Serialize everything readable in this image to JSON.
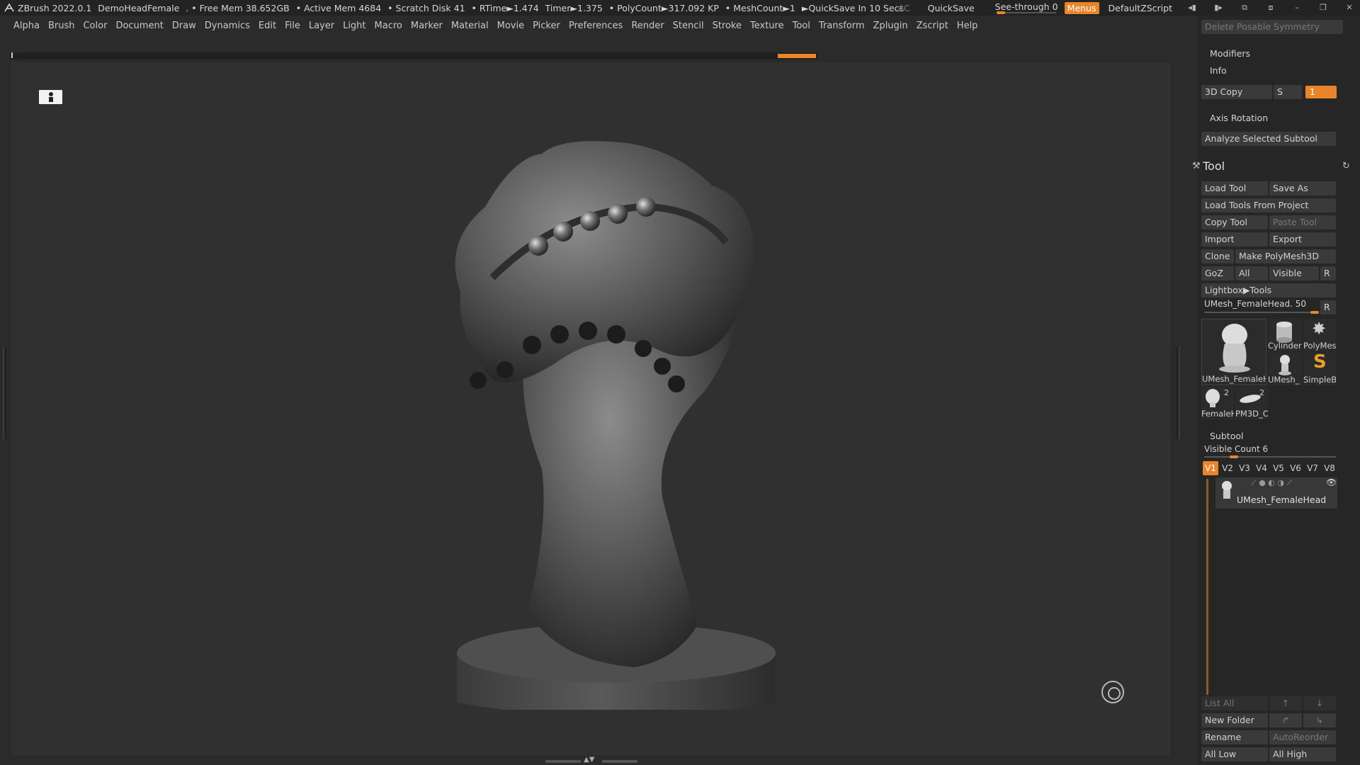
{
  "titlebar": {
    "app": "ZBrush 2022.0.1",
    "project": "DemoHeadFemale",
    "stats": [
      ". • Free Mem 38.652GB",
      "• Active Mem 4684",
      "• Scratch Disk 41",
      "• RTime►1.474",
      "Timer►1.375",
      "• PolyCount►317.092 KP",
      "• MeshCount►1",
      "►QuickSave In 10 Secs"
    ],
    "ac": "AC",
    "quicksave": "QuickSave",
    "seethrough": "See-through  0",
    "menus": "Menus",
    "script": "DefaultZScript"
  },
  "menubar": [
    "Alpha",
    "Brush",
    "Color",
    "Document",
    "Draw",
    "Dynamics",
    "Edit",
    "File",
    "Layer",
    "Light",
    "Macro",
    "Marker",
    "Material",
    "Movie",
    "Picker",
    "Preferences",
    "Render",
    "Stencil",
    "Stroke",
    "Texture",
    "Tool",
    "Transform",
    "Zplugin",
    "Zscript",
    "Help"
  ],
  "rightpanel": {
    "delete_posable_symmetry": "Delete Posable Symmetry",
    "modifiers": "Modifiers",
    "info": "Info",
    "copy3d": "3D Copy",
    "copy_s": "S",
    "copy_field": "1",
    "axis_rotation": "Axis Rotation",
    "analyze_subtool": "Analyze Selected Subtool",
    "tool_title": "Tool",
    "load_tool": "Load Tool",
    "save_as": "Save As",
    "load_tools_from_project": "Load Tools From Project",
    "copy_tool": "Copy Tool",
    "paste_tool": "Paste Tool",
    "import": "Import",
    "export": "Export",
    "clone": "Clone",
    "make_polymesh": "Make PolyMesh3D",
    "goz": "GoZ",
    "all": "All",
    "visible": "Visible",
    "r": "R",
    "lightbox_tools": "Lightbox▶Tools",
    "current_tool": "UMesh_FemaleHead. 50",
    "current_tool_r": "R",
    "thumbs": [
      {
        "caption": "UMesh_FemaleH"
      },
      {
        "caption": "Cylinder"
      },
      {
        "caption": "PolyMes"
      },
      {
        "caption": "UMesh_"
      },
      {
        "caption": "SimpleB"
      },
      {
        "caption": "FemaleH",
        "badge": "2"
      },
      {
        "caption": "PM3D_C",
        "badge": "2"
      }
    ],
    "subtool": "Subtool",
    "visible_count": "Visible Count 6",
    "vbuttons": [
      "V1",
      "V2",
      "V3",
      "V4",
      "V5",
      "V6",
      "V7",
      "V8"
    ],
    "subtool_name": "UMesh_FemaleHead",
    "list_all": "List All",
    "new_folder": "New Folder",
    "rename": "Rename",
    "autoreorder": "AutoReorder",
    "all_low": "All Low",
    "all_high": "All High"
  },
  "colors": {
    "accent": "#e8842a",
    "panel_bg": "#262626",
    "viewport_bg": "#303030"
  }
}
